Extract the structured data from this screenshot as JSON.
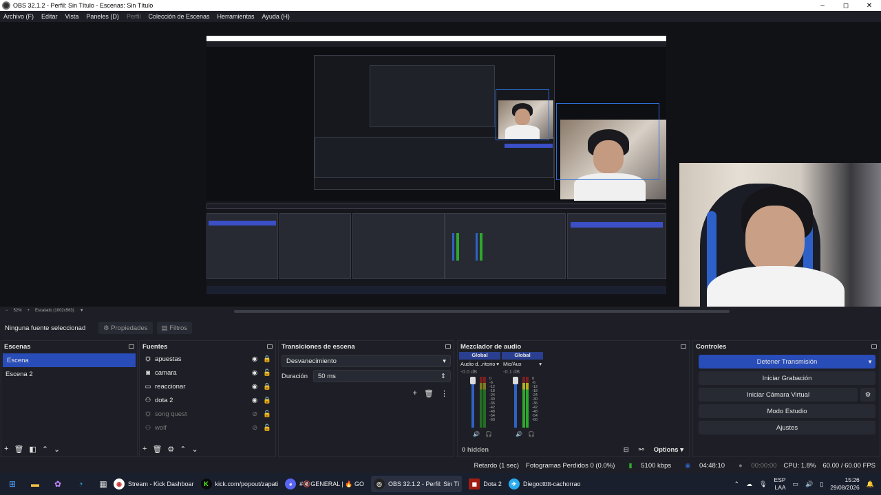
{
  "window": {
    "title": "OBS 32.1.2 - Perfil: Sin Título - Escenas: Sin Título",
    "minimize": "–",
    "maximize": "◻",
    "close": "✕"
  },
  "menu": {
    "archivo": "Archivo (F)",
    "editar": "Editar",
    "vista": "Vista",
    "paneles": "Paneles (D)",
    "perfil": "Perfil",
    "coleccion": "Colección de Escenas",
    "herramientas": "Herramientas",
    "ayuda": "Ayuda (H)"
  },
  "preview_status": {
    "zoom": "52%",
    "scaled": "Escalado (1002x563)"
  },
  "source_toolbar": {
    "no_source": "Ninguna fuente seleccionad",
    "propiedades": "Propiedades",
    "filtros": "Filtros"
  },
  "scenes": {
    "title": "Escenas",
    "items": [
      "Escena",
      "Escena 2"
    ]
  },
  "sources": {
    "title": "Fuentes",
    "items": [
      {
        "name": "apuestas",
        "icon": "⛭"
      },
      {
        "name": "camara",
        "icon": "◙"
      },
      {
        "name": "reaccionar",
        "icon": "▭"
      },
      {
        "name": "dota 2",
        "icon": "⚇"
      },
      {
        "name": "song quest",
        "icon": "⛭"
      },
      {
        "name": "wolf",
        "icon": "⚇"
      }
    ]
  },
  "transitions": {
    "title": "Transiciones de escena",
    "type": "Desvanecimiento",
    "duration_label": "Duración",
    "duration": "50 ms"
  },
  "mixer": {
    "title": "Mezclador de audio",
    "hidden": "0 hidden",
    "options": "Options",
    "channels": [
      {
        "global": "Global",
        "name": "Audio d...ritorio",
        "db": "-0.0 dB",
        "scale": [
          "0",
          "-6",
          "-12",
          "-18",
          "-24",
          "-30",
          "-36",
          "-42",
          "-48",
          "-54",
          "-60"
        ]
      },
      {
        "global": "Global",
        "name": "Mic/Aux",
        "db": "-0.1 dB",
        "scale": [
          "0",
          "-6",
          "-12",
          "-18",
          "-24",
          "-30",
          "-36",
          "-42",
          "-48",
          "-54",
          "-60"
        ]
      }
    ]
  },
  "controls": {
    "title": "Controles",
    "stop_stream": "Detener Transmisión",
    "start_rec": "Iniciar Grabación",
    "virtual_cam": "Iniciar Cámara Virtual",
    "studio": "Modo Estudio",
    "settings": "Ajustes"
  },
  "statusbar": {
    "delay": "Retardo (1 sec)",
    "dropped": "Fotogramas Perdidos 0 (0.0%)",
    "bitrate": "5100 kbps",
    "stream_time": "04:48:10",
    "rec_time": "00:00:00",
    "cpu": "CPU: 1.8%",
    "fps": "60.00 / 60.00 FPS"
  },
  "taskbar": {
    "apps": [
      {
        "label": "Stream - Kick Dashboar",
        "color": "#e8e8e8",
        "glyph": "◉"
      },
      {
        "label": "kick.com/popout/zapati",
        "color": "#53fc18",
        "glyph": "K"
      },
      {
        "label": "#🔇GENERAL | 🔥 GO",
        "color": "#5865f2",
        "glyph": "◕"
      },
      {
        "label": "OBS 32.1.2 - Perfil: Sin Tí",
        "color": "#2c2c2c",
        "glyph": "◎"
      },
      {
        "label": "Dota 2",
        "color": "#a21d12",
        "glyph": "◼"
      },
      {
        "label": "Diegocttttt-cachorrao",
        "color": "#2aabee",
        "glyph": "✈"
      }
    ],
    "lang1": "ESP",
    "lang2": "LAA",
    "time": "15:26",
    "date": "29/08/2026"
  }
}
